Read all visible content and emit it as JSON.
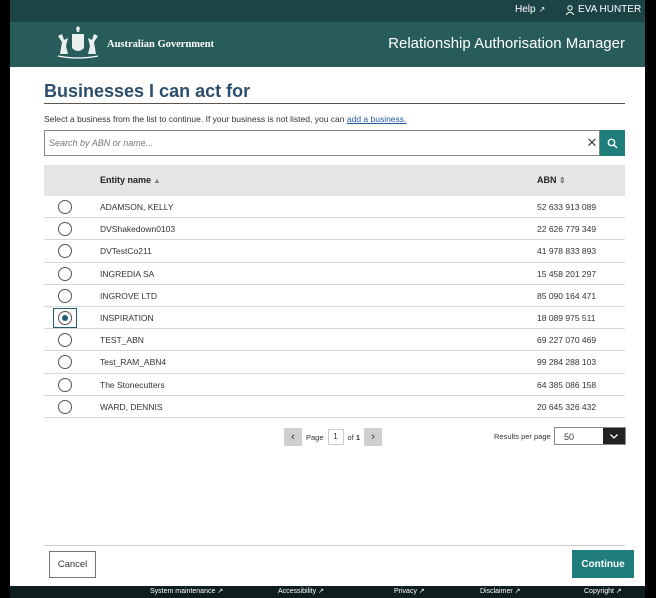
{
  "utility": {
    "help": "Help",
    "user": "EVA HUNTER"
  },
  "header": {
    "government": "Australian Government",
    "app_title": "Relationship Authorisation Manager"
  },
  "page": {
    "title": "Businesses I can act for",
    "instructions_prefix": "Select a business from the list to continue. If your business is not listed, you can ",
    "add_business_link": "add a business.",
    "search_placeholder": "Search by ABN or name..."
  },
  "table": {
    "headers": {
      "name": "Entity name",
      "name_sort": "▲",
      "abn": "ABN",
      "abn_sort": "⇕"
    },
    "rows": [
      {
        "name": "ADAMSON, KELLY",
        "abn": "52 633 913 089",
        "selected": false
      },
      {
        "name": "DVShakedown0103",
        "abn": "22 626 779 349",
        "selected": false
      },
      {
        "name": "DVTestCo211",
        "abn": "41 978 833 893",
        "selected": false
      },
      {
        "name": "INGREDIA SA",
        "abn": "15 458 201 297",
        "selected": false
      },
      {
        "name": "INGROVE LTD",
        "abn": "85 090 164 471",
        "selected": false
      },
      {
        "name": "INSPIRATION",
        "abn": "18 089 975 511",
        "selected": true
      },
      {
        "name": "TEST_ABN",
        "abn": "69 227 070 469",
        "selected": false
      },
      {
        "name": "Test_RAM_ABN4",
        "abn": "99 284 288 103",
        "selected": false
      },
      {
        "name": "The Stonecutters",
        "abn": "64 385 086 158",
        "selected": false
      },
      {
        "name": "WARD, DENNIS",
        "abn": "20 645 326 432",
        "selected": false
      }
    ]
  },
  "pagination": {
    "page_label": "Page",
    "current_page": "1",
    "of_label": "of",
    "total_pages": "1",
    "results_per_page_label": "Results per page",
    "results_per_page": "50"
  },
  "actions": {
    "cancel": "Cancel",
    "continue": "Continue"
  },
  "footer": {
    "links": [
      "System maintenance",
      "Accessibility",
      "Privacy",
      "Disclaimer",
      "Copyright"
    ]
  },
  "colors": {
    "header": "#285c5b",
    "utility_bar": "#1c4446",
    "accent": "#1f7d7c",
    "title": "#2d4f6e"
  }
}
